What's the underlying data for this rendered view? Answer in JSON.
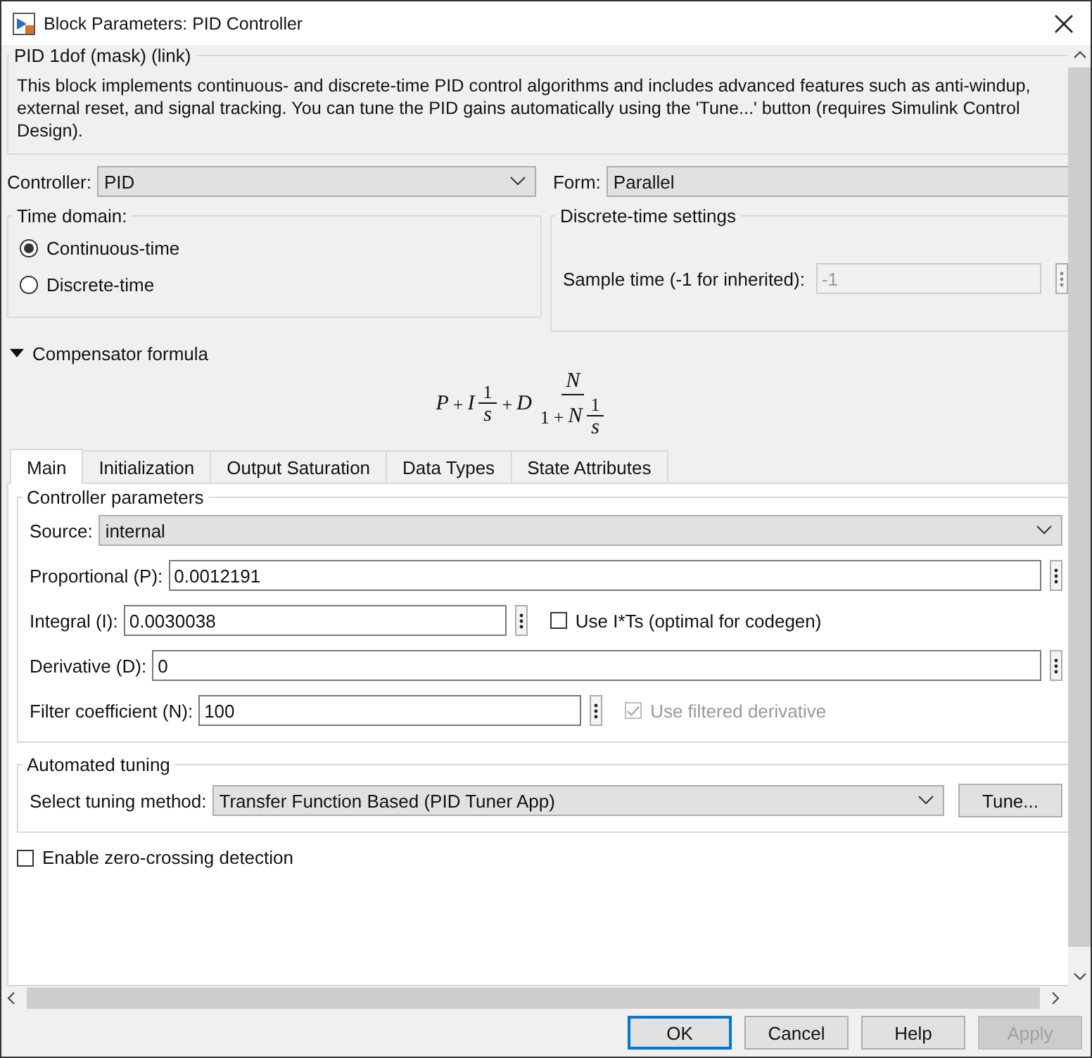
{
  "window": {
    "title": "Block Parameters: PID Controller"
  },
  "mask": {
    "title": "PID 1dof (mask) (link)",
    "description": "This block implements continuous- and discrete-time PID control algorithms and includes advanced features such as anti-windup, external reset, and signal tracking. You can tune the PID gains automatically using the 'Tune...' button (requires Simulink Control Design)."
  },
  "controller": {
    "label": "Controller:",
    "value": "PID"
  },
  "form": {
    "label": "Form:",
    "value": "Parallel"
  },
  "time_domain": {
    "title": "Time domain:",
    "options": [
      {
        "label": "Continuous-time",
        "selected": true
      },
      {
        "label": "Discrete-time",
        "selected": false
      }
    ]
  },
  "discrete_settings": {
    "title": "Discrete-time settings",
    "sample_time": {
      "label": "Sample time (-1 for inherited):",
      "value": "-1",
      "disabled": true
    }
  },
  "compensator": {
    "label": "Compensator formula",
    "expanded": true,
    "formula": [
      {
        "kind": "sym",
        "text": "P"
      },
      {
        "kind": "op",
        "text": "+"
      },
      {
        "kind": "sym",
        "text": "I"
      },
      {
        "kind": "frac",
        "num": [
          {
            "kind": "num",
            "text": "1"
          }
        ],
        "den": [
          {
            "kind": "sym",
            "text": "s"
          }
        ]
      },
      {
        "kind": "op",
        "text": "+"
      },
      {
        "kind": "sym",
        "text": "D"
      },
      {
        "kind": "frac",
        "num": [
          {
            "kind": "sym",
            "text": "N"
          }
        ],
        "den": [
          {
            "kind": "num",
            "text": "1"
          },
          {
            "kind": "op",
            "text": "+"
          },
          {
            "kind": "sym",
            "text": "N"
          },
          {
            "kind": "frac",
            "num": [
              {
                "kind": "num",
                "text": "1"
              }
            ],
            "den": [
              {
                "kind": "sym",
                "text": "s"
              }
            ]
          }
        ]
      }
    ]
  },
  "tabs": [
    {
      "label": "Main",
      "selected": true
    },
    {
      "label": "Initialization",
      "selected": false
    },
    {
      "label": "Output Saturation",
      "selected": false
    },
    {
      "label": "Data Types",
      "selected": false
    },
    {
      "label": "State Attributes",
      "selected": false
    }
  ],
  "controller_parameters": {
    "title": "Controller parameters",
    "rows": [
      {
        "kind": "select",
        "label": "Source:",
        "value": "internal"
      },
      {
        "kind": "field",
        "label": "Proportional (P):",
        "value": "0.0012191"
      },
      {
        "kind": "field_option",
        "label": "Integral (I):",
        "value": "0.0030038",
        "option": {
          "label": "Use I*Ts (optimal for codegen)",
          "checked": false,
          "disabled": false
        }
      },
      {
        "kind": "field",
        "label": "Derivative (D):",
        "value": "0"
      },
      {
        "kind": "field_option",
        "label": "Filter coefficient (N):",
        "value": "100",
        "option": {
          "label": "Use filtered derivative",
          "checked": true,
          "disabled": true
        }
      }
    ]
  },
  "automated_tuning": {
    "title": "Automated tuning",
    "label": "Select tuning method:",
    "value": "Transfer Function Based (PID Tuner App)",
    "button": "Tune..."
  },
  "zero_crossing": {
    "label": "Enable zero-crossing detection",
    "checked": false
  },
  "buttons": [
    {
      "label": "OK",
      "default": true,
      "disabled": false
    },
    {
      "label": "Cancel",
      "default": false,
      "disabled": false
    },
    {
      "label": "Help",
      "default": false,
      "disabled": false
    },
    {
      "label": "Apply",
      "default": false,
      "disabled": true
    }
  ]
}
